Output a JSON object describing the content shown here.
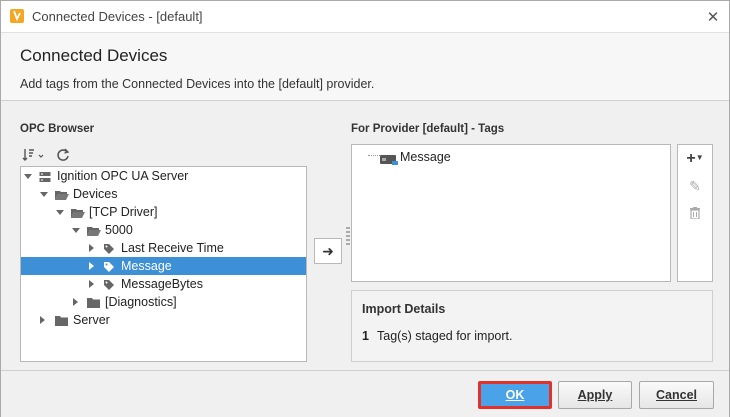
{
  "window": {
    "title": "Connected Devices - [default]"
  },
  "header": {
    "title": "Connected Devices",
    "description": "Add tags from the Connected Devices into the [default] provider."
  },
  "opc_browser": {
    "label": "OPC Browser",
    "tree": [
      {
        "label": "Ignition OPC UA Server",
        "icon": "server-icon",
        "expanded": true,
        "selected": false
      },
      {
        "label": "Devices",
        "icon": "folder-open-icon",
        "expanded": true,
        "selected": false
      },
      {
        "label": "[TCP Driver]",
        "icon": "folder-open-icon",
        "expanded": true,
        "selected": false
      },
      {
        "label": "5000",
        "icon": "folder-open-icon",
        "expanded": true,
        "selected": false
      },
      {
        "label": "Last Receive Time",
        "icon": "tag-icon",
        "expanded": false,
        "selected": false
      },
      {
        "label": "Message",
        "icon": "tag-icon",
        "expanded": false,
        "selected": true
      },
      {
        "label": "MessageBytes",
        "icon": "tag-icon",
        "expanded": false,
        "selected": false
      },
      {
        "label": "[Diagnostics]",
        "icon": "folder-icon",
        "expanded": false,
        "selected": false
      },
      {
        "label": "Server",
        "icon": "folder-icon",
        "expanded": false,
        "selected": false
      }
    ]
  },
  "provider_tags": {
    "label": "For Provider [default] - Tags",
    "items": [
      {
        "label": "Message",
        "icon": "opc-tag-icon"
      }
    ]
  },
  "import_details": {
    "title": "Import Details",
    "count": "1",
    "text": "Tag(s) staged for import."
  },
  "buttons": {
    "ok": "OK",
    "apply": "Apply",
    "cancel": "Cancel"
  },
  "colors": {
    "selection": "#3d8fd6",
    "ok_button": "#4aa3e8",
    "ok_highlight": "#e0312d",
    "app_icon": "#f5a623"
  }
}
